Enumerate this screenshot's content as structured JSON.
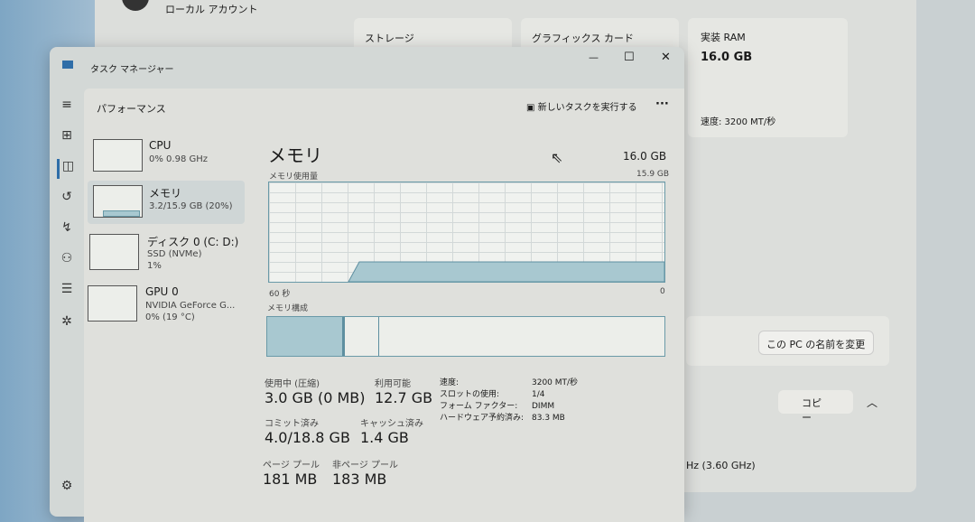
{
  "settings": {
    "account": "ローカル アカウント",
    "storage": "ストレージ",
    "graphics": "グラフィックス カード",
    "ram_label": "実装 RAM",
    "ram_value": "16.0 GB",
    "ram_speed": "速度: 3200 MT/秒",
    "rename": "この PC の名前を変更",
    "copy": "コピー",
    "cpu_freq": "Hz (3.60 GHz)"
  },
  "window": {
    "title": "タスク マネージャー",
    "minimize": "—",
    "maximize": "☐",
    "close": "✕"
  },
  "header": {
    "title": "パフォーマンス",
    "run_task": "新しいタスクを実行する",
    "more": "···"
  },
  "devices": [
    {
      "name": "CPU",
      "line1": "0%  0.98 GHz",
      "line2": ""
    },
    {
      "name": "メモリ",
      "line1": "3.2/15.9 GB (20%)",
      "line2": ""
    },
    {
      "name": "ディスク 0 (C: D:)",
      "line1": "SSD (NVMe)",
      "line2": "1%"
    },
    {
      "name": "GPU 0",
      "line1": "NVIDIA GeForce G...",
      "line2": "0%  (19 °C)"
    }
  ],
  "memory": {
    "title": "メモリ",
    "total": "16.0 GB",
    "usage_label": "メモリ使用量",
    "usage_max": "15.9 GB",
    "time_left": "60 秒",
    "time_right": "0",
    "composition_label": "メモリ構成",
    "usage_fraction": 0.2,
    "stats": [
      {
        "label": "使用中 (圧縮)",
        "value": "3.0 GB (0 MB)"
      },
      {
        "label": "利用可能",
        "value": "12.7 GB"
      },
      {
        "label": "コミット済み",
        "value": "4.0/18.8 GB"
      },
      {
        "label": "キャッシュ済み",
        "value": "1.4 GB"
      },
      {
        "label": "ページ プール",
        "value": "181 MB"
      },
      {
        "label": "非ページ プール",
        "value": "183 MB"
      }
    ],
    "details": [
      {
        "label": "速度:",
        "value": "3200 MT/秒"
      },
      {
        "label": "スロットの使用:",
        "value": "1/4"
      },
      {
        "label": "フォーム ファクター:",
        "value": "DIMM"
      },
      {
        "label": "ハードウェア予約済み:",
        "value": "83.3 MB"
      }
    ]
  }
}
